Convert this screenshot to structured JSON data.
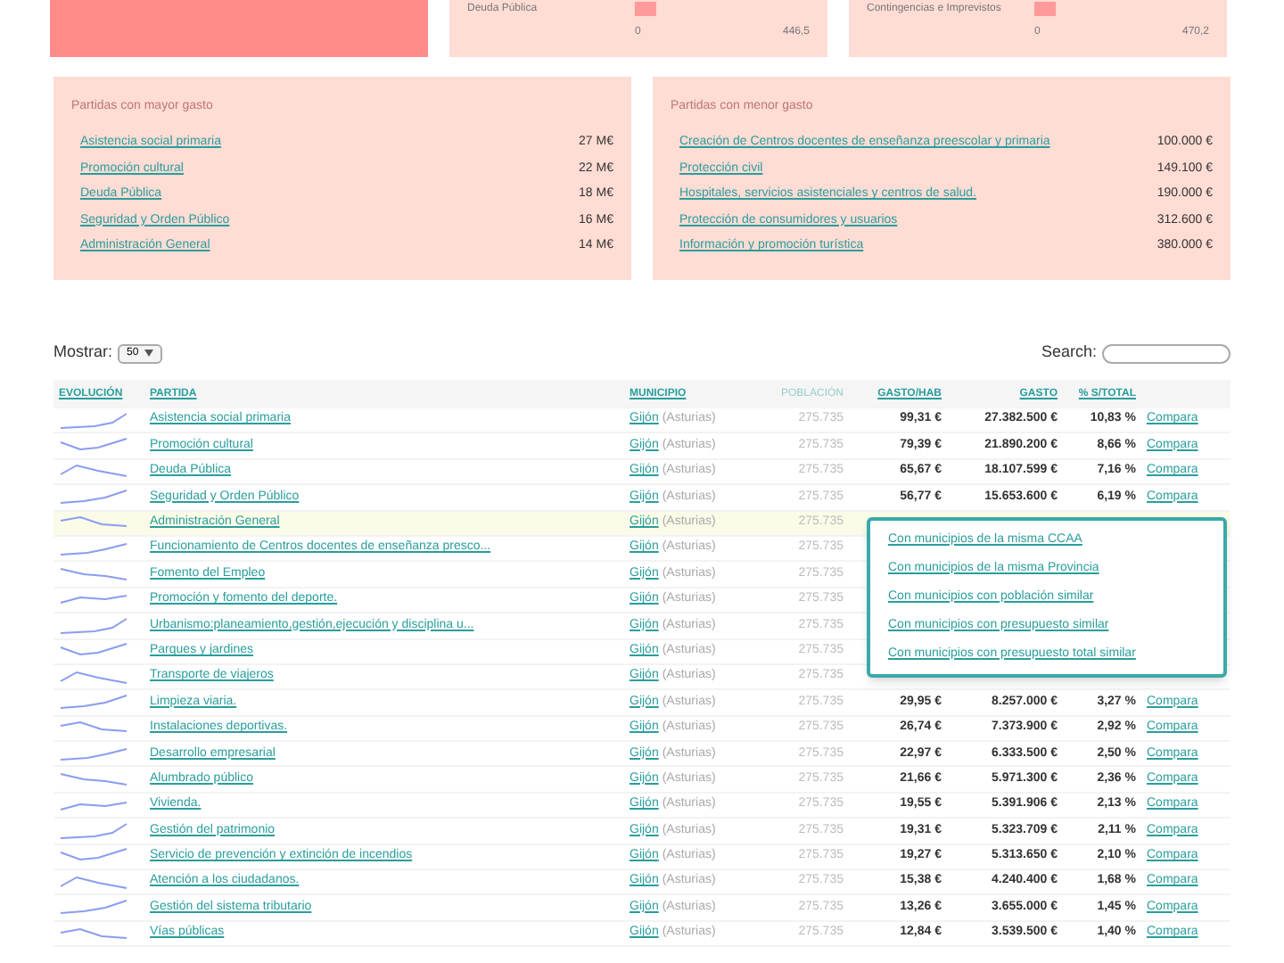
{
  "top_charts": [
    {
      "kind": "block"
    },
    {
      "kind": "bar",
      "label": "Deuda Pública",
      "tick_min": "0",
      "tick_max": "446,5"
    },
    {
      "kind": "bar",
      "label": "Contingencias e Imprevistos",
      "tick_min": "0",
      "tick_max": "470,2"
    }
  ],
  "highest": {
    "title": "Partidas con mayor gasto",
    "items": [
      {
        "name": "Asistencia social primaria",
        "amount": "27 M€"
      },
      {
        "name": "Promoción cultural",
        "amount": "22 M€"
      },
      {
        "name": "Deuda Pública",
        "amount": "18 M€"
      },
      {
        "name": "Seguridad y Orden Público",
        "amount": "16 M€"
      },
      {
        "name": "Administración General",
        "amount": "14 M€"
      }
    ]
  },
  "lowest": {
    "title": "Partidas con menor gasto",
    "items": [
      {
        "name": "Creación de Centros docentes de enseñanza preescolar y primaria",
        "amount": "100.000 €"
      },
      {
        "name": "Protección civil",
        "amount": "149.100 €"
      },
      {
        "name": "Hospitales, servicios asistenciales y centros de salud.",
        "amount": "190.000 €"
      },
      {
        "name": "Protección de consumidores y usuarios",
        "amount": "312.600 €"
      },
      {
        "name": "Información y promoción turística",
        "amount": "380.000 €"
      }
    ]
  },
  "show": {
    "label": "Mostrar:",
    "value": "50"
  },
  "search": {
    "label": "Search:"
  },
  "table": {
    "columns": [
      "EVOLUCIÓN",
      "PARTIDA",
      "MUNICIPIO",
      "POBLACIÓN",
      "GASTO/HAB",
      "GASTO",
      "% S/TOTAL"
    ],
    "rows": [
      {
        "partida": "Asistencia social primaria",
        "municipio": "Gijón",
        "region": "(Asturias)",
        "poblacion": "275.735",
        "gasto_hab": "99,31 €",
        "gasto": "27.382.500 €",
        "total": "10,83 %",
        "action": "Compara",
        "selected": false
      },
      {
        "partida": "Promoción cultural",
        "municipio": "Gijón",
        "region": "(Asturias)",
        "poblacion": "275.735",
        "gasto_hab": "79,39 €",
        "gasto": "21.890.200 €",
        "total": "8,66 %",
        "action": "Compara",
        "selected": false
      },
      {
        "partida": "Deuda Pública",
        "municipio": "Gijón",
        "region": "(Asturias)",
        "poblacion": "275.735",
        "gasto_hab": "65,67 €",
        "gasto": "18.107.599 €",
        "total": "7,16 %",
        "action": "Compara",
        "selected": false
      },
      {
        "partida": "Seguridad y Orden Público",
        "municipio": "Gijón",
        "region": "(Asturias)",
        "poblacion": "275.735",
        "gasto_hab": "56,77 €",
        "gasto": "15.653.600 €",
        "total": "6,19 %",
        "action": "Compara",
        "selected": false
      },
      {
        "partida": "Administración General",
        "municipio": "Gijón",
        "region": "(Asturias)",
        "poblacion": "275.735",
        "selected": true
      },
      {
        "partida": "Funcionamiento de Centros docentes de enseñanza presco...",
        "municipio": "Gijón",
        "region": "(Asturias)",
        "poblacion": "275.735",
        "selected": false
      },
      {
        "partida": "Fomento del Empleo",
        "municipio": "Gijón",
        "region": "(Asturias)",
        "poblacion": "275.735",
        "selected": false
      },
      {
        "partida": "Promoción y fomento del deporte.",
        "municipio": "Gijón",
        "region": "(Asturias)",
        "poblacion": "275.735",
        "selected": false
      },
      {
        "partida": "Urbanismo:planeamiento,gestión,ejecución y disciplina u...",
        "municipio": "Gijón",
        "region": "(Asturias)",
        "poblacion": "275.735",
        "selected": false
      },
      {
        "partida": "Parques y jardines",
        "municipio": "Gijón",
        "region": "(Asturias)",
        "poblacion": "275.735",
        "selected": false
      },
      {
        "partida": "Transporte de viajeros",
        "municipio": "Gijón",
        "region": "(Asturias)",
        "poblacion": "275.735",
        "selected": false
      },
      {
        "partida": "Limpieza viaria.",
        "municipio": "Gijón",
        "region": "(Asturias)",
        "poblacion": "275.735",
        "gasto_hab": "29,95 €",
        "gasto": "8.257.000 €",
        "total": "3,27 %",
        "action": "Compara",
        "selected": false
      },
      {
        "partida": "Instalaciones deportivas.",
        "municipio": "Gijón",
        "region": "(Asturias)",
        "poblacion": "275.735",
        "gasto_hab": "26,74 €",
        "gasto": "7.373.900 €",
        "total": "2,92 %",
        "action": "Compara",
        "selected": false
      },
      {
        "partida": "Desarrollo empresarial",
        "municipio": "Gijón",
        "region": "(Asturias)",
        "poblacion": "275.735",
        "gasto_hab": "22,97 €",
        "gasto": "6.333.500 €",
        "total": "2,50 %",
        "action": "Compara",
        "selected": false
      },
      {
        "partida": "Alumbrado público",
        "municipio": "Gijón",
        "region": "(Asturias)",
        "poblacion": "275.735",
        "gasto_hab": "21,66 €",
        "gasto": "5.971.300 €",
        "total": "2,36 %",
        "action": "Compara",
        "selected": false
      },
      {
        "partida": "Vivienda.",
        "municipio": "Gijón",
        "region": "(Asturias)",
        "poblacion": "275.735",
        "gasto_hab": "19,55 €",
        "gasto": "5.391.906 €",
        "total": "2,13 %",
        "action": "Compara",
        "selected": false
      },
      {
        "partida": "Gestión del patrimonio",
        "municipio": "Gijón",
        "region": "(Asturias)",
        "poblacion": "275.735",
        "gasto_hab": "19,31 €",
        "gasto": "5.323.709 €",
        "total": "2,11 %",
        "action": "Compara",
        "selected": false
      },
      {
        "partida": "Servicio de prevención y extinción de incendios",
        "municipio": "Gijón",
        "region": "(Asturias)",
        "poblacion": "275.735",
        "gasto_hab": "19,27 €",
        "gasto": "5.313.650 €",
        "total": "2,10 %",
        "action": "Compara",
        "selected": false
      },
      {
        "partida": "Atención a los ciudadanos.",
        "municipio": "Gijón",
        "region": "(Asturias)",
        "poblacion": "275.735",
        "gasto_hab": "15,38 €",
        "gasto": "4.240.400 €",
        "total": "1,68 %",
        "action": "Compara",
        "selected": false
      },
      {
        "partida": "Gestión del sistema tributario",
        "municipio": "Gijón",
        "region": "(Asturias)",
        "poblacion": "275.735",
        "gasto_hab": "13,26 €",
        "gasto": "3.655.000 €",
        "total": "1,45 %",
        "action": "Compara",
        "selected": false
      },
      {
        "partida": "Vías públicas",
        "municipio": "Gijón",
        "region": "(Asturias)",
        "poblacion": "275.735",
        "gasto_hab": "12,84 €",
        "gasto": "3.539.500 €",
        "total": "1,40 %",
        "action": "Compara",
        "selected": false
      }
    ]
  },
  "compare_menu": [
    "Con municipios de la misma CCAA",
    "Con municipios de la misma Provincia",
    "Con municipios con población similar",
    "Con municipios con presupuesto similar",
    "Con municipios con presupuesto total similar"
  ]
}
